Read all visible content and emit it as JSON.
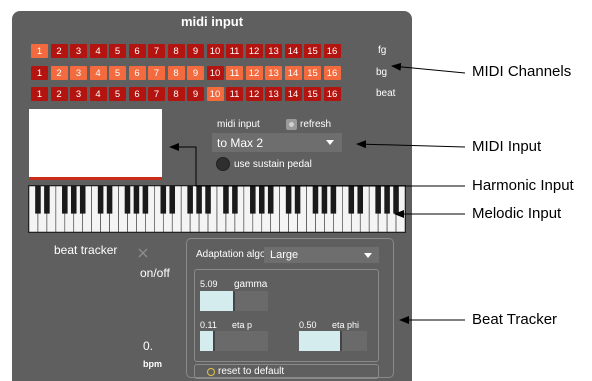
{
  "panel": {
    "title": "midi input",
    "channels": {
      "numbers": [
        "1",
        "2",
        "3",
        "4",
        "5",
        "6",
        "7",
        "8",
        "9",
        "10",
        "11",
        "12",
        "13",
        "14",
        "15",
        "16"
      ],
      "rows": [
        {
          "label": "fg",
          "selected": [
            "1"
          ]
        },
        {
          "label": "bg",
          "selected": [
            "2",
            "3",
            "4",
            "5",
            "6",
            "7",
            "8",
            "9",
            "11",
            "12",
            "13",
            "14",
            "15",
            "16"
          ]
        },
        {
          "label": "beat",
          "selected": [
            "10"
          ]
        }
      ],
      "colors": {
        "selected": "#f36a3e",
        "unselected": "#b3140f"
      }
    },
    "midi_input": {
      "label": "midi input",
      "refresh_label": "refresh",
      "selected_device": "to Max 2",
      "sustain_label": "use sustain pedal",
      "sustain_icon": "toggle-circle-icon"
    },
    "beat_tracker": {
      "label": "beat tracker",
      "onoff_label": "on/off",
      "onoff_icon": "x-icon",
      "algorithm_label": "Adaptation algorithm :",
      "algorithm_value": "Large",
      "gamma": {
        "value": "5.09",
        "label": "gamma",
        "level": 0.5
      },
      "eta_p": {
        "value": "0.11",
        "label": "eta p",
        "level": 0.2
      },
      "eta_phi": {
        "value": "0.50",
        "label": "eta phi",
        "level": 0.62
      },
      "bpm_value": "0.",
      "bpm_label": "bpm",
      "reset_label": "reset to default"
    }
  },
  "annotations": [
    "MIDI Channels",
    "MIDI Input",
    "Harmonic Input",
    "Melodic Input",
    "Beat Tracker"
  ]
}
